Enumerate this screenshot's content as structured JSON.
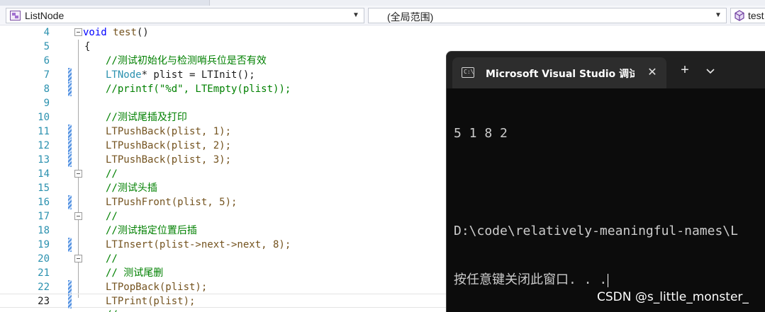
{
  "navbar": {
    "class_combo": "ListNode",
    "scope_combo": "(全局范围)",
    "member_combo": "test"
  },
  "editor": {
    "lines": [
      {
        "num": "4"
      },
      {
        "num": "5"
      },
      {
        "num": "6"
      },
      {
        "num": "7"
      },
      {
        "num": "8"
      },
      {
        "num": "9"
      },
      {
        "num": "10"
      },
      {
        "num": "11"
      },
      {
        "num": "12"
      },
      {
        "num": "13"
      },
      {
        "num": "14"
      },
      {
        "num": "15"
      },
      {
        "num": "16"
      },
      {
        "num": "17"
      },
      {
        "num": "18"
      },
      {
        "num": "19"
      },
      {
        "num": "20"
      },
      {
        "num": "21"
      },
      {
        "num": "22"
      },
      {
        "num": "23"
      }
    ],
    "code": {
      "l4_kw": "void",
      "l4_fn": "test",
      "l4_rest": "()",
      "l5": "{",
      "l6": "//测试初始化与检测哨兵位是否有效",
      "l7_type": "LTNode",
      "l7_rest": "* plist = LTInit();",
      "l8_a": "//printf(",
      "l8_str": "\"%d\"",
      "l8_b": ", LTEmpty(plist));",
      "l10": "//测试尾插及打印",
      "l11": "LTPushBack(plist, 1);",
      "l12": "LTPushBack(plist, 2);",
      "l13": "LTPushBack(plist, 3);",
      "l14": "//",
      "l15": "//测试头插",
      "l16": "LTPushFront(plist, 5);",
      "l17": "//",
      "l18": "//测试指定位置后插",
      "l19": "LTInsert(plist->next->next, 8);",
      "l20": "//",
      "l21": "// 测试尾删",
      "l22": "LTPopBack(plist);",
      "l23": "LTPrint(plist);",
      "l24": "//"
    }
  },
  "terminal": {
    "tab_title": "Microsoft Visual Studio 调试控制台",
    "tab_icon_text": "C:\\",
    "new_tab": "+",
    "output": [
      "5 1 8 2",
      "",
      "D:\\code\\relatively-meaningful-names\\L",
      "按任意键关闭此窗口. . ."
    ]
  },
  "watermark": "CSDN @s_little_monster_"
}
